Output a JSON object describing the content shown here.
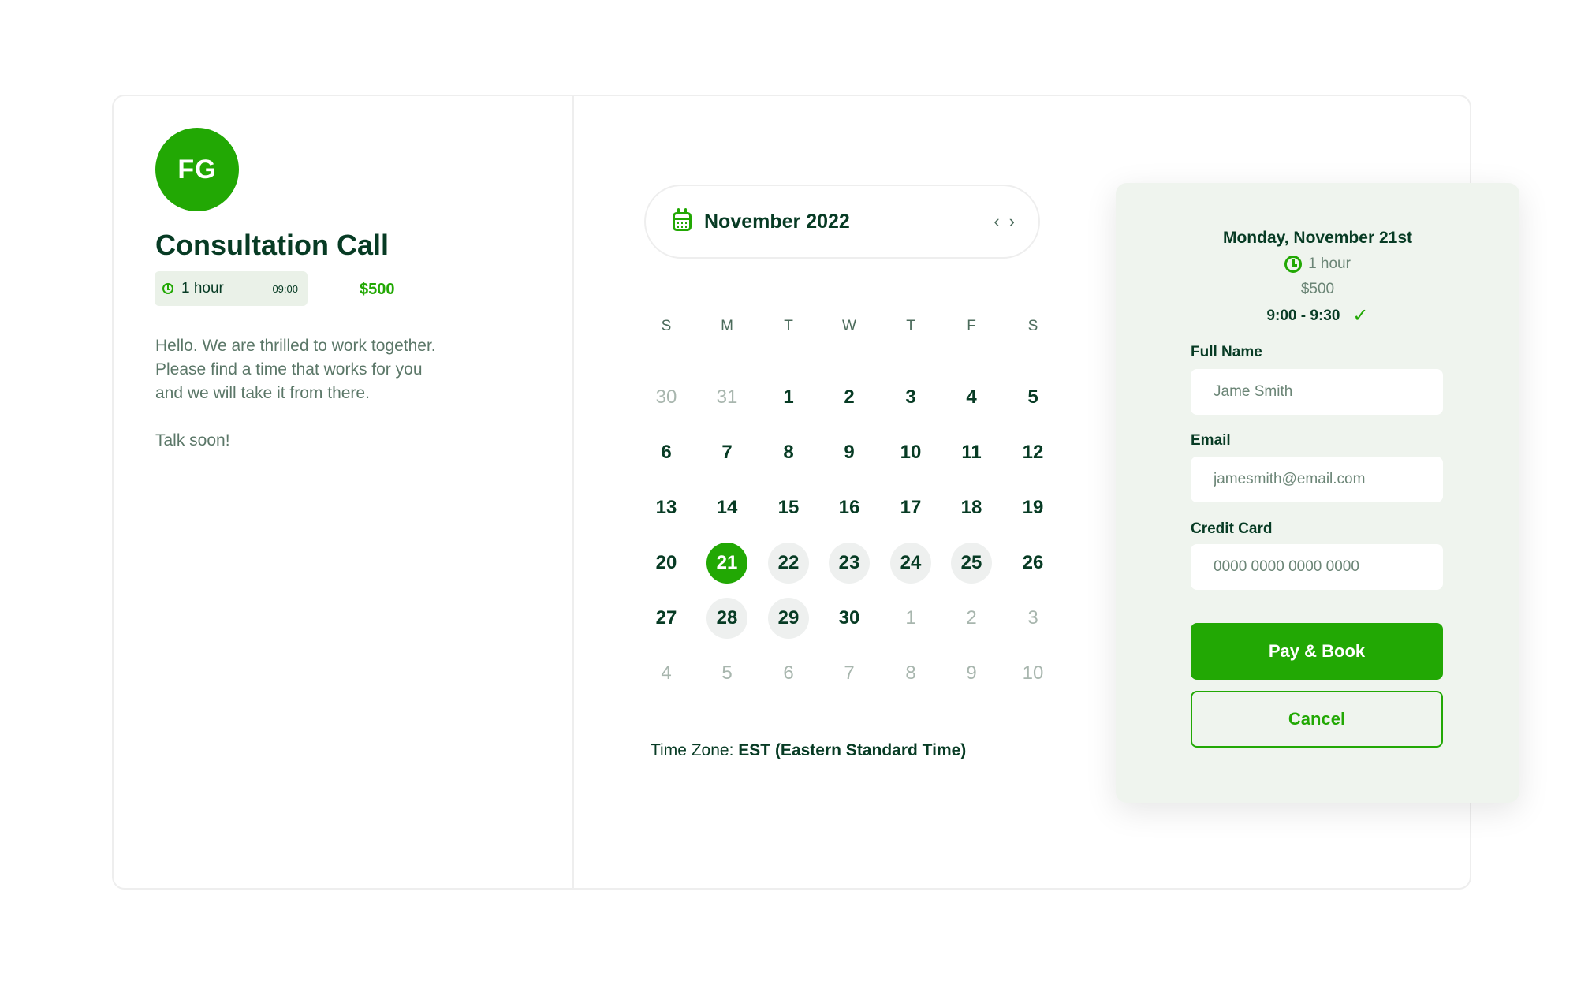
{
  "host": {
    "initials": "FG"
  },
  "event": {
    "title": "Consultation Call",
    "duration": "1 hour",
    "time": "09:00",
    "price": "$500",
    "description": [
      "Hello. We are thrilled to work together.",
      "Please find a time that works for you",
      "and we will take it from there."
    ],
    "signoff": "Talk soon!"
  },
  "calendar": {
    "month_label": "November 2022",
    "weekdays": [
      "S",
      "M",
      "T",
      "W",
      "T",
      "F",
      "S"
    ],
    "weeks": [
      [
        {
          "d": "30",
          "s": "muted"
        },
        {
          "d": "31",
          "s": "muted"
        },
        {
          "d": "1",
          "s": ""
        },
        {
          "d": "2",
          "s": ""
        },
        {
          "d": "3",
          "s": ""
        },
        {
          "d": "4",
          "s": ""
        },
        {
          "d": "5",
          "s": ""
        }
      ],
      [
        {
          "d": "6",
          "s": ""
        },
        {
          "d": "7",
          "s": ""
        },
        {
          "d": "8",
          "s": ""
        },
        {
          "d": "9",
          "s": ""
        },
        {
          "d": "10",
          "s": ""
        },
        {
          "d": "11",
          "s": ""
        },
        {
          "d": "12",
          "s": ""
        }
      ],
      [
        {
          "d": "13",
          "s": ""
        },
        {
          "d": "14",
          "s": ""
        },
        {
          "d": "15",
          "s": ""
        },
        {
          "d": "16",
          "s": ""
        },
        {
          "d": "17",
          "s": ""
        },
        {
          "d": "18",
          "s": ""
        },
        {
          "d": "19",
          "s": ""
        }
      ],
      [
        {
          "d": "20",
          "s": ""
        },
        {
          "d": "21",
          "s": "selected"
        },
        {
          "d": "22",
          "s": "available"
        },
        {
          "d": "23",
          "s": "available"
        },
        {
          "d": "24",
          "s": "available"
        },
        {
          "d": "25",
          "s": "available"
        },
        {
          "d": "26",
          "s": ""
        }
      ],
      [
        {
          "d": "27",
          "s": ""
        },
        {
          "d": "28",
          "s": "available"
        },
        {
          "d": "29",
          "s": "available"
        },
        {
          "d": "30",
          "s": ""
        },
        {
          "d": "1",
          "s": "muted"
        },
        {
          "d": "2",
          "s": "muted"
        },
        {
          "d": "3",
          "s": "muted"
        }
      ],
      [
        {
          "d": "4",
          "s": "muted"
        },
        {
          "d": "5",
          "s": "muted"
        },
        {
          "d": "6",
          "s": "muted"
        },
        {
          "d": "7",
          "s": "muted"
        },
        {
          "d": "8",
          "s": "muted"
        },
        {
          "d": "9",
          "s": "muted"
        },
        {
          "d": "10",
          "s": "muted"
        }
      ]
    ],
    "timezone_label": "Time Zone: ",
    "timezone_value": "EST (Eastern Standard Time)"
  },
  "booking": {
    "date": "Monday, November 21st",
    "duration": "1 hour",
    "price": "$500",
    "slot": "9:00 - 9:30",
    "fields": {
      "name_label": "Full Name",
      "name_placeholder": "Jame Smith",
      "email_label": "Email",
      "email_placeholder": "jamesmith@email.com",
      "card_label": "Credit Card",
      "card_placeholder": "0000 0000 0000 0000"
    },
    "pay_label": "Pay & Book",
    "cancel_label": "Cancel"
  },
  "colors": {
    "brand_green": "#22a804",
    "dark_text": "#073b24",
    "panel_bg": "#eff4ee"
  },
  "icons": {
    "event_duration": "clock-icon",
    "month_picker": "calendar-icon",
    "slot_confirmed": "check-icon"
  }
}
